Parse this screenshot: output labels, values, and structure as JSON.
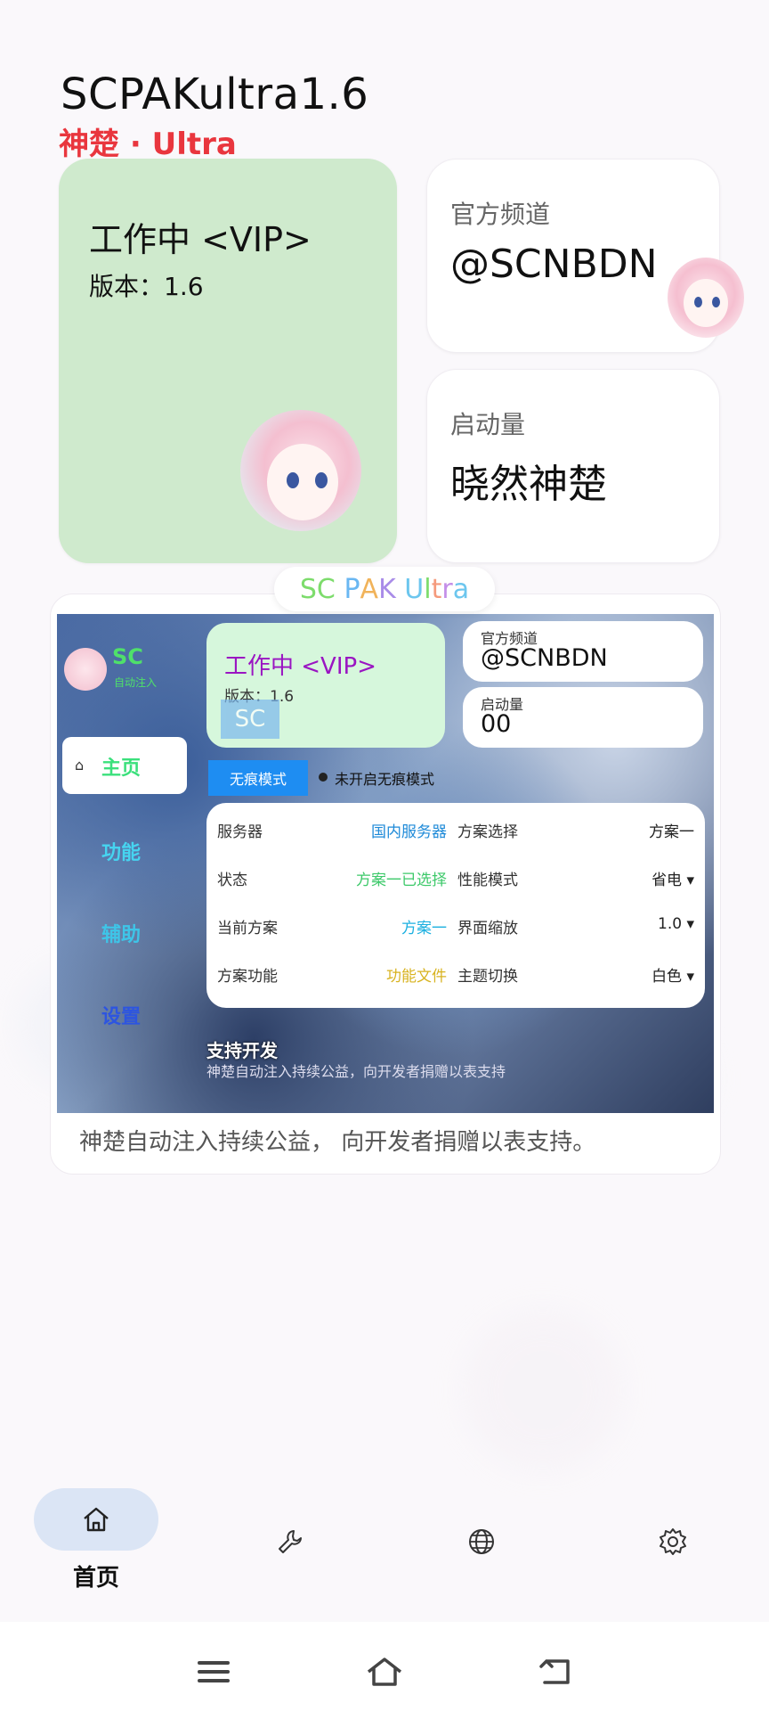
{
  "app": {
    "title": "SCPAKultra1.6",
    "subtitle": "神楚 · Ultra"
  },
  "status_card": {
    "status": "工作中 <VIP>",
    "version": "版本：1.6"
  },
  "channel_card": {
    "label": "官方频道",
    "value": "@SCNBDN"
  },
  "launch_card": {
    "label": "启动量",
    "value": "晓然神楚"
  },
  "preview": {
    "title": [
      {
        "t": "SC",
        "color": "#7ddc6c"
      },
      {
        "t": " ",
        "color": "#000"
      },
      {
        "t": "P",
        "color": "#6ab7f2"
      },
      {
        "t": "A",
        "color": "#f1b35a"
      },
      {
        "t": "K",
        "color": "#a98ce8"
      },
      {
        "t": " ",
        "color": "#000"
      },
      {
        "t": "U",
        "color": "#6cc6ee"
      },
      {
        "t": "l",
        "color": "#7ddc6c"
      },
      {
        "t": "t",
        "color": "#f59a7c"
      },
      {
        "t": "r",
        "color": "#c48ee8"
      },
      {
        "t": "a",
        "color": "#6cc6ee"
      }
    ],
    "caption": "神楚自动注入持续公益， 向开发者捐赠以表支持。",
    "inner": {
      "logo": "SC",
      "logo_sub": "自动注入",
      "nav": {
        "home": "主页",
        "func": "功能",
        "assist": "辅助",
        "settings": "设置"
      },
      "status": "工作中 <VIP>",
      "version": "版本：1.6",
      "badge": "SC",
      "channel_label": "官方频道",
      "channel_value": "@SCNBDN",
      "launch_label": "启动量",
      "launch_value": "00",
      "stealth_button": "无痕模式",
      "stealth_status": "未开启无痕模式",
      "rows": [
        {
          "k1": "服务器",
          "v1": "国内服务器",
          "c1": "blue",
          "k2": "方案选择",
          "v2": "方案一"
        },
        {
          "k1": "状态",
          "v1": "方案一已选择",
          "c1": "green",
          "k2": "性能模式",
          "v2": "省电 ▾"
        },
        {
          "k1": "当前方案",
          "v1": "方案一",
          "c1": "cyan",
          "k2": "界面缩放",
          "v2": "1.0 ▾"
        },
        {
          "k1": "方案功能",
          "v1": "功能文件",
          "c1": "gold",
          "k2": "主题切换",
          "v2": "白色 ▾"
        }
      ],
      "support_title": "支持开发",
      "support_desc": "神楚自动注入持续公益，向开发者捐赠以表支持"
    }
  },
  "bottom_nav": {
    "active_label": "首页",
    "icons": [
      "home-icon",
      "wrench-icon",
      "globe-icon",
      "gear-icon"
    ]
  },
  "colors": {
    "accent_green": "#cfeacd",
    "title_red": "#e9363e",
    "nav_pill": "#dbe5f5"
  }
}
